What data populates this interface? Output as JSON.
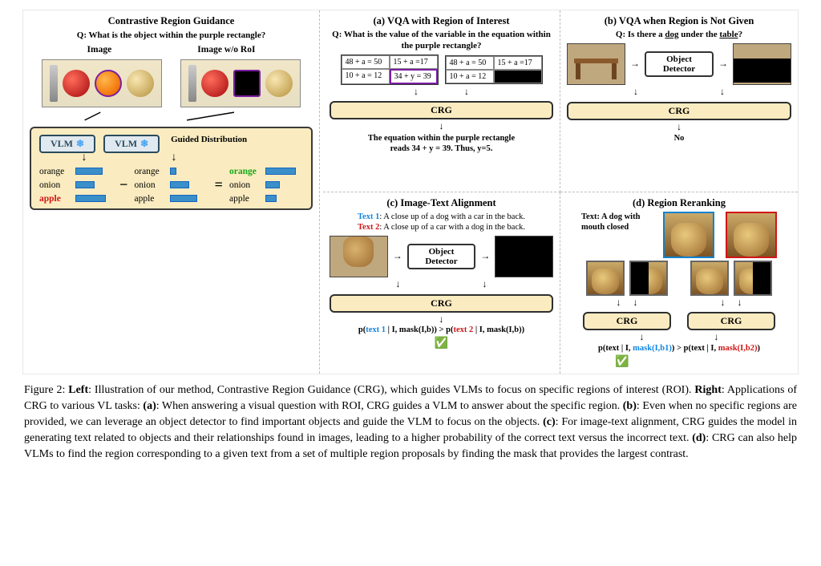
{
  "left": {
    "title": "Contrastive Region Guidance",
    "question": "Q: What is the object within the purple rectangle?",
    "img_label": "Image",
    "img_wo_label": "Image w/o RoI",
    "vlm_label": "VLM",
    "guided_label": "Guided Distribution",
    "minus": "−",
    "equals": "=",
    "items": {
      "orange": "orange",
      "onion": "onion",
      "apple": "apple"
    }
  },
  "a": {
    "title": "(a) VQA with Region of Interest",
    "question": "Q: What is the value of the variable in the equation within the purple rectangle?",
    "cells": {
      "c1": "48 + a = 50",
      "c2": "15 + a =17",
      "c3": "10 + a = 12",
      "c4": "34 + y = 39"
    },
    "crg": "CRG",
    "answer_l1": "The equation within the purple rectangle",
    "answer_l2": "reads 34 + y = 39. Thus, y=5."
  },
  "b": {
    "title": "(b) VQA when Region is Not Given",
    "question_pre": "Q: Is there a ",
    "dog": "dog",
    "mid": " under the ",
    "table": "table",
    "qmark": "?",
    "obj_det": "Object Detector",
    "crg": "CRG",
    "answer": "No"
  },
  "c": {
    "title": "(c) Image-Text Alignment",
    "t1_label": "Text 1",
    "t1": ": A close up of a dog with a car in the back.",
    "t2_label": "Text 2",
    "t2": ": A close up of a car with a dog in the back.",
    "obj_det": "Object Detector",
    "crg": "CRG",
    "prob_pre": "p(",
    "prob_t1": "text 1",
    "prob_mid1": " | I, mask(I,b))  >  p(",
    "prob_t2": "text 2",
    "prob_suf": " | I, mask(I,b))",
    "check": "✅"
  },
  "d": {
    "title": "(d) Region Reranking",
    "text_label": "Text: A dog with mouth closed",
    "crg": "CRG",
    "prob_pre": "p(text | I, ",
    "m1": "mask(I,b1)",
    "gt": ") > p(text | I, ",
    "m2": "mask(I,b2)",
    "suf": ")",
    "check": "✅"
  },
  "caption": {
    "fig": "Figure 2: ",
    "left_label": "Left",
    "left_text": ": Illustration of our method, Contrastive Region Guidance (CRG), which guides VLMs to focus on specific regions of interest (ROI). ",
    "right_label": "Right",
    "right_text": ": Applications of CRG to various VL tasks: ",
    "a_label": "(a)",
    "a_text": ": When answering a visual question with ROI, CRG guides a VLM to answer about the specific region. ",
    "b_label": "(b)",
    "b_text": ": Even when no specific regions are provided, we can leverage an object detector to find important objects and guide the VLM to focus on the objects. ",
    "c_label": "(c)",
    "c_text": ": For image-text alignment, CRG guides the model in generating text related to objects and their relationships found in images, leading to a higher probability of the correct text versus the incorrect text. ",
    "d_label": "(d)",
    "d_text": ": CRG can also help VLMs to find the region corresponding to a given text from a set of multiple region proposals by finding the mask that provides the largest contrast."
  }
}
